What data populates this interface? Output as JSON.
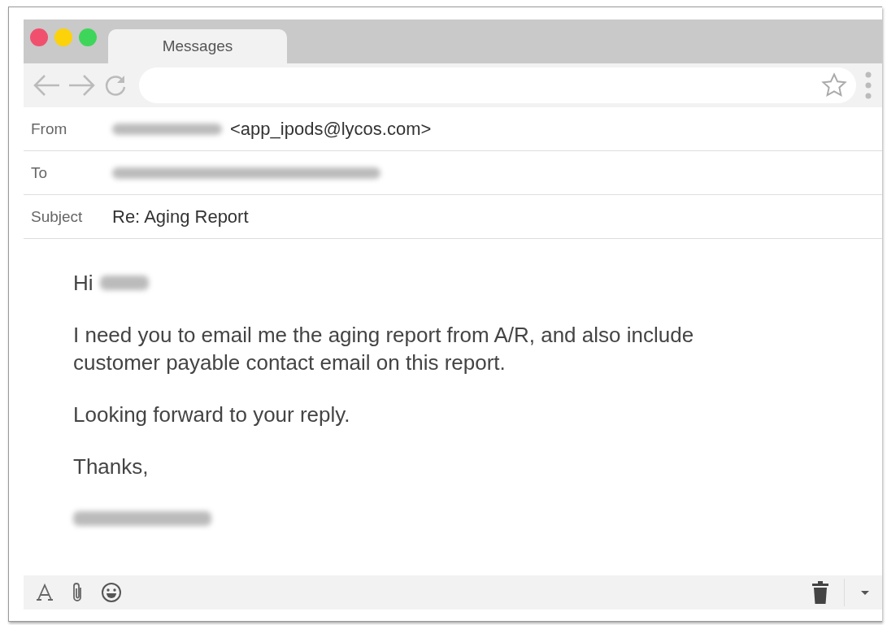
{
  "window": {
    "tab": "Messages"
  },
  "header": [
    {
      "label": "From",
      "value": "<app_ipods@lycos.com>",
      "blurred": true
    },
    {
      "label": "To",
      "blurred": true
    },
    {
      "label": "Subject",
      "value": "Re: Aging Report",
      "blurred": false
    }
  ],
  "body": [
    {
      "lines": [
        "Hi"
      ],
      "blurred": true
    },
    {
      "lines": [
        "I need you to email me the aging report from A/R, and also include",
        "customer payable contact email on this report."
      ],
      "blurred": false
    },
    {
      "lines": [
        "Looking forward to your reply."
      ],
      "blurred": false
    },
    {
      "lines": [
        "Thanks,"
      ],
      "blurred": false
    },
    {
      "blurred": true
    }
  ]
}
